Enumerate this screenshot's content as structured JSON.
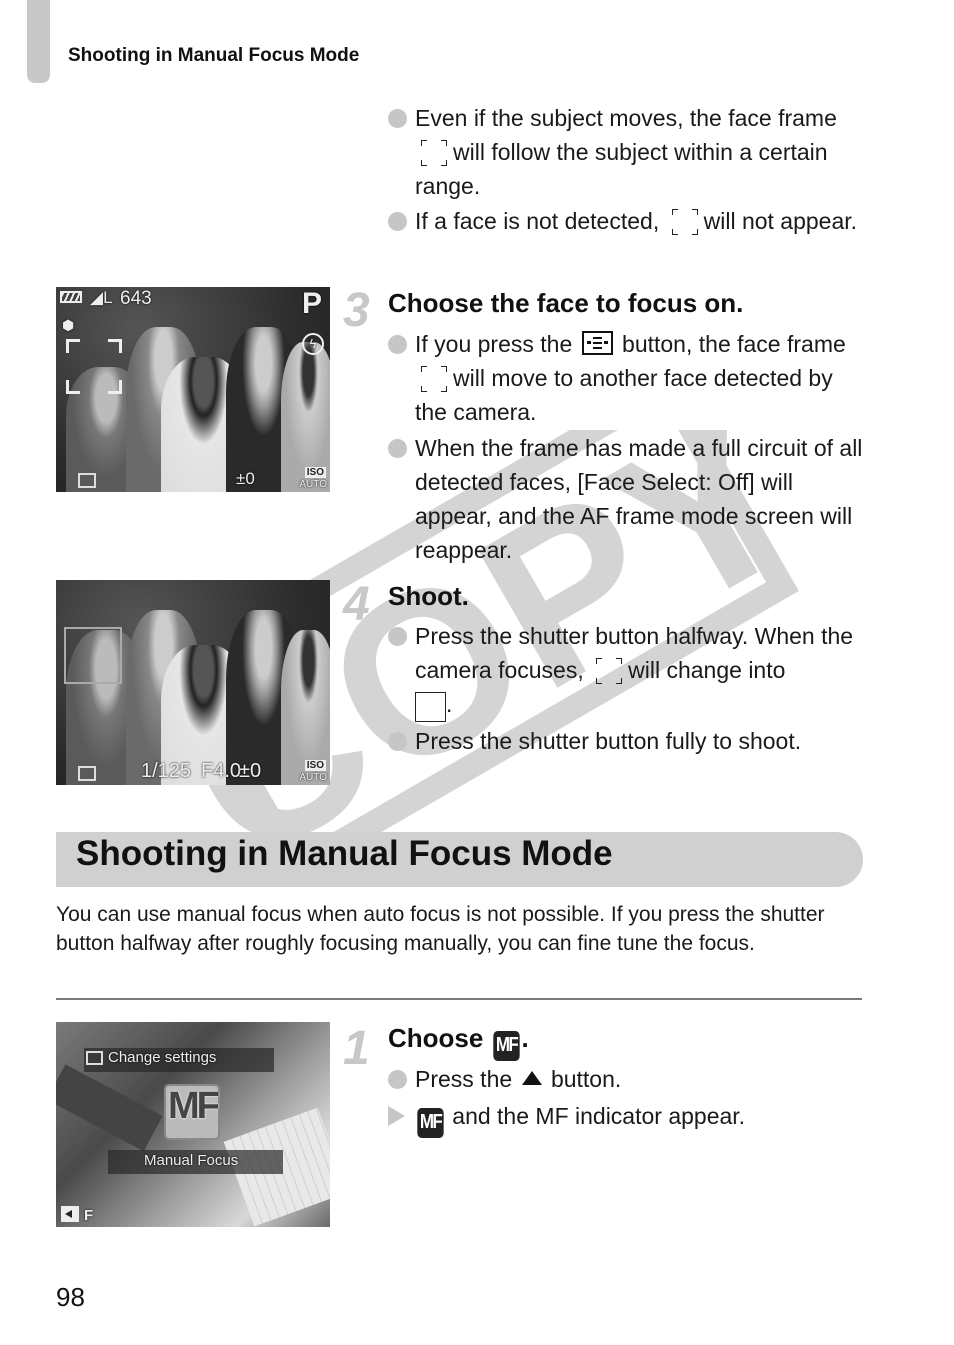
{
  "header": {
    "running_title": "Shooting in Manual Focus Mode"
  },
  "watermark": {
    "text": "COPY"
  },
  "top_bullets": [
    {
      "before": "Even if the subject moves, the face frame",
      "after": "will follow the subject within a certain range."
    },
    {
      "before": "If a face is not detected,",
      "after": "will not appear."
    }
  ],
  "step3": {
    "number": "3",
    "title": "Choose the face to focus on.",
    "bullets": [
      {
        "before": "If you press the",
        "mid": "button, the face frame",
        "after": "will move to another face detected by the camera."
      },
      {
        "text": "When the frame has made a full circuit of all detected faces, [Face Select: Off] will appear, and the AF frame mode screen will reappear."
      }
    ],
    "screen": {
      "battery_icon": "battery-icon",
      "quality": "L",
      "shots_remaining": "643",
      "mode": "P",
      "exposure": "±0",
      "iso_top": "ISO",
      "iso_bottom": "AUTO"
    }
  },
  "step4": {
    "number": "4",
    "title": "Shoot.",
    "bullets": [
      {
        "before": "Press the shutter button halfway. When the camera focuses,",
        "after": "will change into",
        "end": "."
      },
      {
        "text": "Press the shutter button fully to shoot."
      }
    ],
    "screen": {
      "shutter": "1/125",
      "aperture": "F4.0",
      "exposure": "±0",
      "iso_top": "ISO",
      "iso_bottom": "AUTO"
    }
  },
  "section": {
    "title": "Shooting in Manual Focus Mode",
    "intro": "You can use manual focus when auto focus is not possible. If you press the shutter button halfway after roughly focusing manually, you can fine tune the focus."
  },
  "step1": {
    "number": "1",
    "title_before": "Choose",
    "title_icon": "MF",
    "title_after": ".",
    "bullets": [
      {
        "before": "Press the",
        "after": "button."
      },
      {
        "icon": "MF",
        "after": "and the MF indicator appear."
      }
    ],
    "screen": {
      "change_settings": "Change settings",
      "mf_label": "MF",
      "manual_focus": "Manual Focus"
    }
  },
  "footer": {
    "page_number": "98"
  }
}
